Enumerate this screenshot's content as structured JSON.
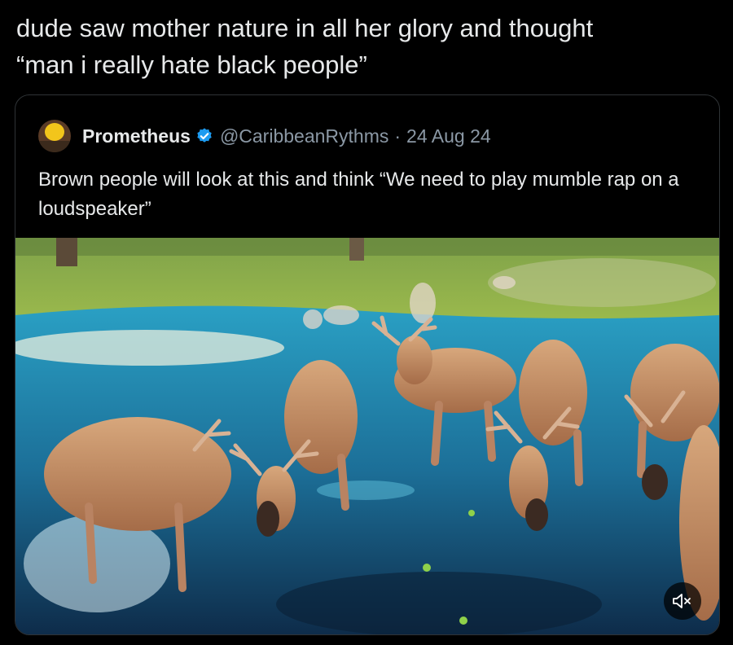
{
  "post": {
    "text": "dude saw mother nature in all her glory and thought\n“man i really hate black people”"
  },
  "quoted_post": {
    "display_name": "Prometheus",
    "verified": true,
    "handle": "@CaribbeanRythms",
    "separator": "·",
    "date": "24 Aug 24",
    "text": "Brown people will look at this and think “We need to play mumble rap on a loudspeaker”",
    "media": {
      "type": "video",
      "muted": true,
      "icon": "speaker-muted-icon"
    }
  },
  "colors": {
    "background": "#000000",
    "text": "#e7e9ea",
    "secondary_text": "#8b98a5",
    "verified_badge": "#1d9bf0",
    "card_border": "#2f3336"
  }
}
